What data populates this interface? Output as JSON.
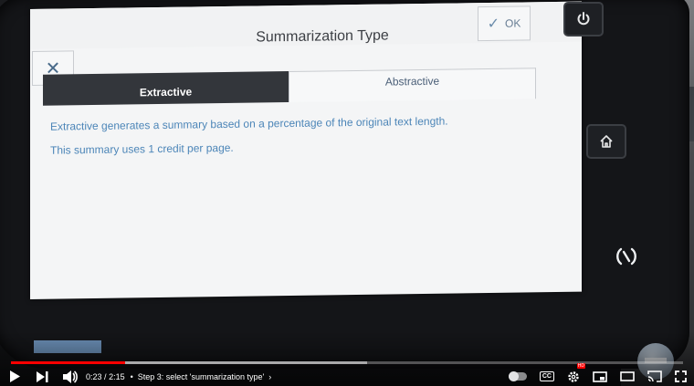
{
  "screen": {
    "title": "Summarization Type",
    "ok_label": "OK",
    "tabs": [
      {
        "label": "Extractive",
        "active": true
      },
      {
        "label": "Abstractive",
        "active": false
      }
    ],
    "description": [
      "Extractive generates a summary based on a percentage of the original text length.",
      "This summary uses 1 credit per page."
    ]
  },
  "player": {
    "current_time": "0:23",
    "separator": "/",
    "duration": "2:15",
    "chapter": "Step 3: select 'summarization type'",
    "progress_played": 0.17,
    "progress_buffered": 0.53,
    "hd_badge": "HD",
    "cc_label": "CC"
  },
  "colors": {
    "accent": "#ff0000",
    "tab_active_bg": "#33363b",
    "description_text": "#4d86b8"
  },
  "icons": {
    "close": "close-icon",
    "ok_check": "check-icon",
    "power": "power-icon",
    "home": "home-icon",
    "nfc": "nfc-icon"
  }
}
